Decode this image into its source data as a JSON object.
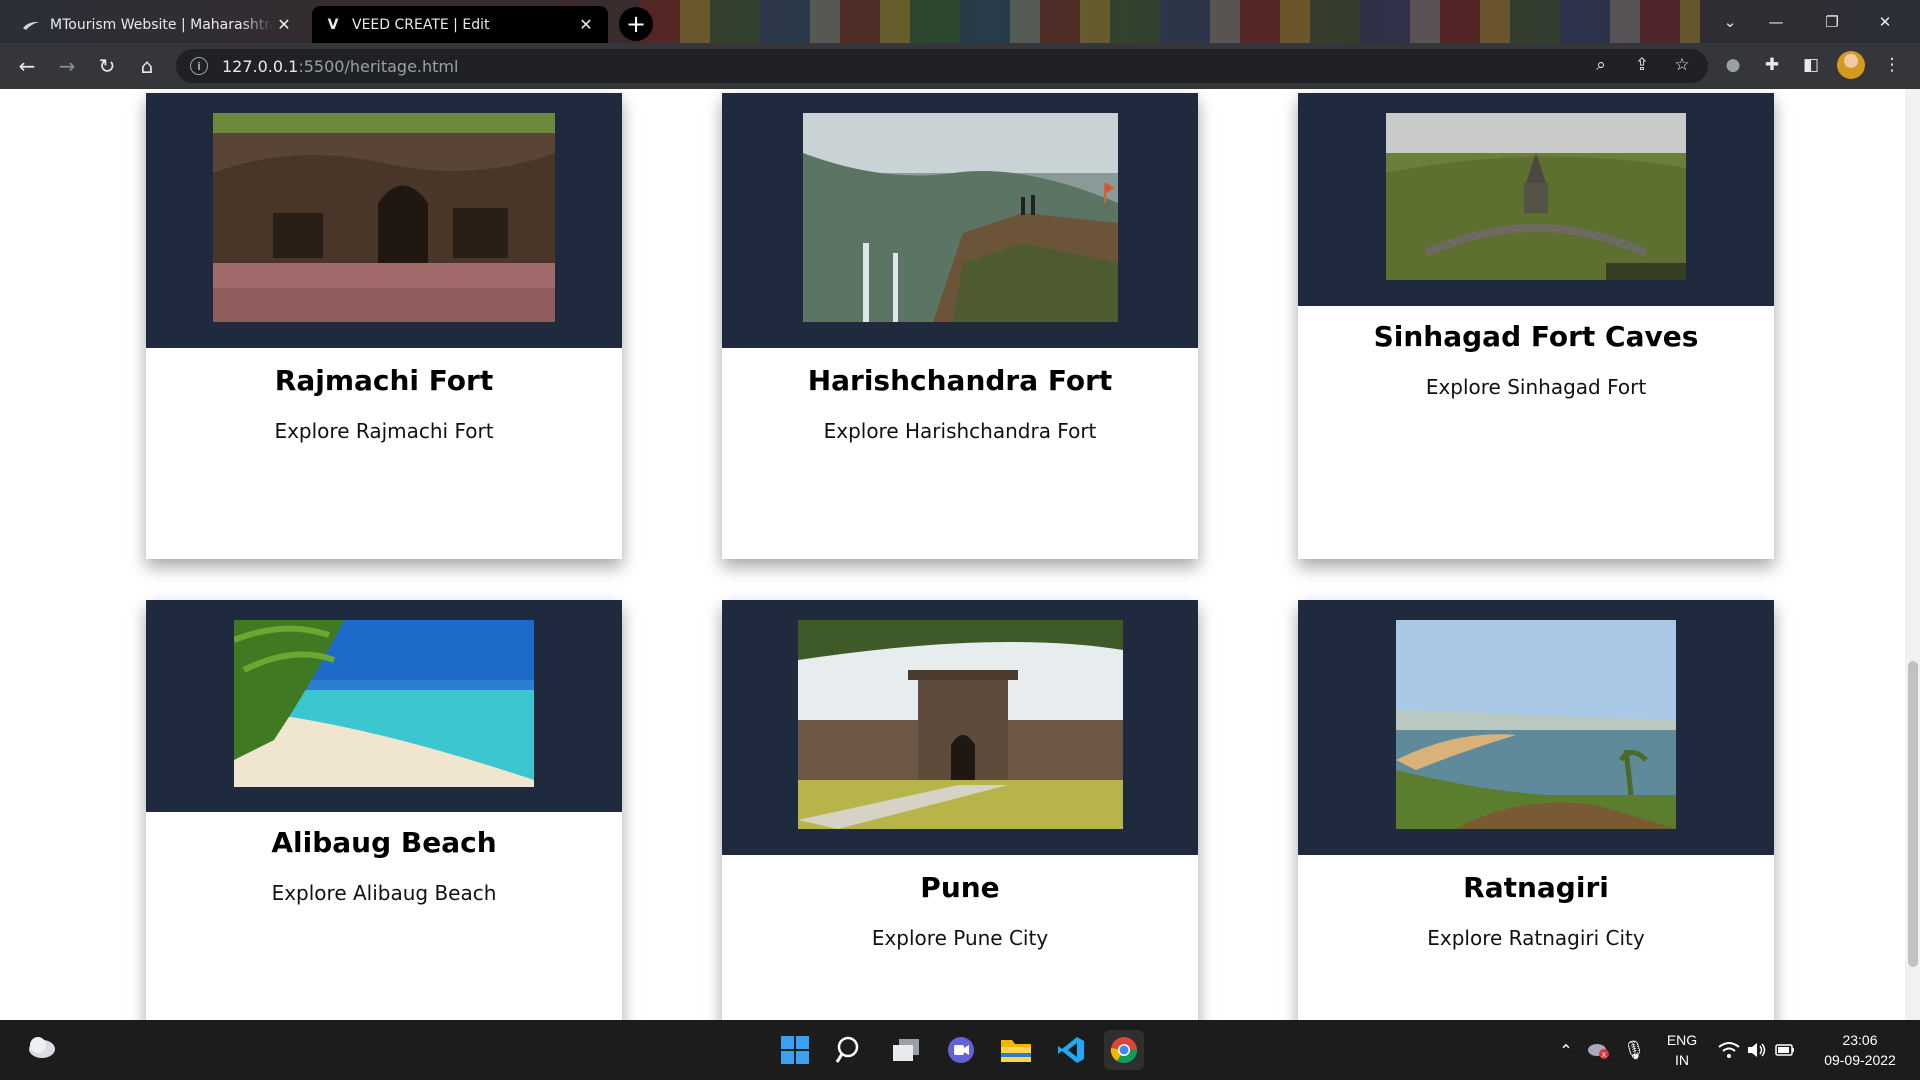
{
  "browser": {
    "tabs": [
      {
        "title": "MTourism Website | Maharashtra",
        "favicon": "swoosh-icon",
        "active": false
      },
      {
        "title": "VEED CREATE | Edit",
        "favicon": "V",
        "active": true
      }
    ],
    "new_tab": "+",
    "url_host": "127.0.0.1",
    "url_path": ":5500/heritage.html"
  },
  "cards": [
    {
      "name": "Rajmachi Fort",
      "desc": "Explore Rajmachi Fort"
    },
    {
      "name": "Harishchandra Fort",
      "desc": "Explore Harishchandra Fort"
    },
    {
      "name": "Sinhagad Fort Caves",
      "desc": "Explore Sinhagad Fort"
    },
    {
      "name": "Alibaug Beach",
      "desc": "Explore Alibaug Beach"
    },
    {
      "name": "Pune",
      "desc": "Explore Pune City"
    },
    {
      "name": "Ratnagiri",
      "desc": "Explore Ratnagiri City"
    }
  ],
  "colors": {
    "card_media_bg": "#1f2a3e",
    "chrome_toolbar": "#35363a"
  },
  "taskbar": {
    "lang_top": "ENG",
    "lang_bottom": "IN",
    "time": "23:06",
    "date": "09-09-2022"
  }
}
